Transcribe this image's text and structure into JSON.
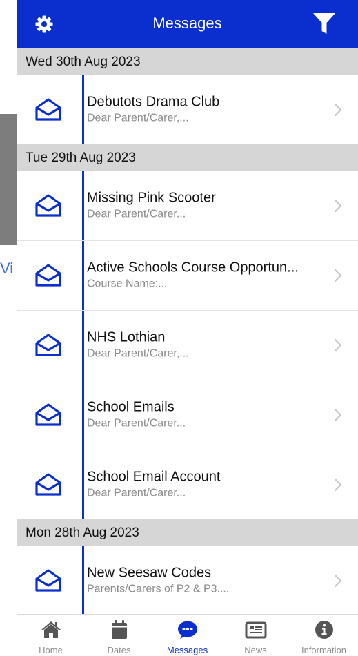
{
  "background": {
    "bleed_text": "Vi"
  },
  "header": {
    "title": "Messages",
    "left_icon": "gear-icon",
    "right_icon": "filter-icon"
  },
  "colors": {
    "brand": "#0b2fcf",
    "date_bar": "#d6d6d6",
    "subject": "#111111",
    "preview": "#8a8a8a",
    "tab_inactive": "#8e8e8e"
  },
  "groups": [
    {
      "date": "Wed  30th Aug 2023",
      "messages": [
        {
          "subject": "Debutots Drama Club",
          "preview": "Dear Parent/Carer,..."
        }
      ]
    },
    {
      "date": "Tue  29th Aug 2023",
      "messages": [
        {
          "subject": "Missing Pink Scooter",
          "preview": "Dear Parent/Carer..."
        },
        {
          "subject": "Active Schools Course Opportun...",
          "preview": "Course Name:..."
        },
        {
          "subject": "NHS Lothian",
          "preview": "Dear Parent/Carer,..."
        },
        {
          "subject": "School Emails",
          "preview": "Dear Parent/Carer..."
        },
        {
          "subject": "School Email Account",
          "preview": "Dear Parent/Carer..."
        }
      ]
    },
    {
      "date": "Mon  28th Aug 2023",
      "messages": [
        {
          "subject": "New Seesaw Codes",
          "preview": "Parents/Carers of P2 & P3...."
        }
      ]
    }
  ],
  "tabs": [
    {
      "label": "Home",
      "icon": "home-icon",
      "active": false
    },
    {
      "label": "Dates",
      "icon": "calendar-icon",
      "active": false
    },
    {
      "label": "Messages",
      "icon": "chat-bubble-icon",
      "active": true
    },
    {
      "label": "News",
      "icon": "newspaper-icon",
      "active": false
    },
    {
      "label": "Information",
      "icon": "info-icon",
      "active": false
    }
  ]
}
